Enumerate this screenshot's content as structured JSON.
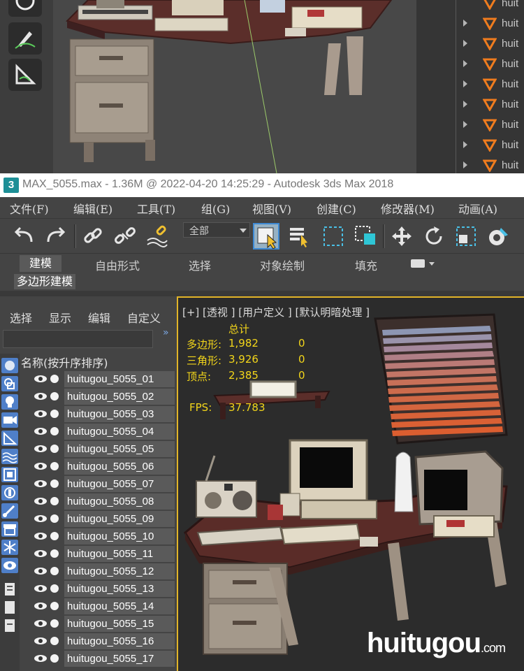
{
  "top_panel": {
    "rows": [
      "huit",
      "huit",
      "huit",
      "huit",
      "huit",
      "huit",
      "huit",
      "huit",
      "huit"
    ]
  },
  "titlebar": {
    "title": "MAX_5055.max - 1.36M @ 2022-04-20 14:25:29 - Autodesk 3ds Max 2018"
  },
  "menu": {
    "items": [
      "文件(F)",
      "编辑(E)",
      "工具(T)",
      "组(G)",
      "视图(V)",
      "创建(C)",
      "修改器(M)",
      "动画(A)"
    ]
  },
  "toolbar": {
    "selection_filter": "全部"
  },
  "ribbon": {
    "tabs": [
      "建模",
      "自由形式",
      "选择",
      "对象绘制",
      "填充"
    ],
    "sub_tab": "多边形建模"
  },
  "explorer": {
    "menu": [
      "选择",
      "显示",
      "编辑",
      "自定义"
    ],
    "column_header": "名称(按升序排序)",
    "items": [
      "huitugou_5055_01",
      "huitugou_5055_02",
      "huitugou_5055_03",
      "huitugou_5055_04",
      "huitugou_5055_05",
      "huitugou_5055_06",
      "huitugou_5055_07",
      "huitugou_5055_08",
      "huitugou_5055_09",
      "huitugou_5055_10",
      "huitugou_5055_11",
      "huitugou_5055_12",
      "huitugou_5055_13",
      "huitugou_5055_14",
      "huitugou_5055_15",
      "huitugou_5055_16",
      "huitugou_5055_17"
    ]
  },
  "viewport": {
    "label": "[+] [透视 ] [用户定义 ] [默认明暗处理 ]",
    "stats_title": "总计",
    "stats": [
      {
        "label": "多边形:",
        "value": "1,982",
        "sel": "0"
      },
      {
        "label": "三角形:",
        "value": "3,926",
        "sel": "0"
      },
      {
        "label": "顶点:",
        "value": "2,385",
        "sel": "0"
      }
    ],
    "fps_label": "FPS:",
    "fps_value": "37.783"
  },
  "watermark": {
    "main": "huitugou",
    "suffix": ".com"
  },
  "colors": {
    "accent": "#3e8ad4",
    "viewport_border": "#e2b428",
    "stats_text": "#f2d51a",
    "object_icon": "#f07c1e"
  }
}
